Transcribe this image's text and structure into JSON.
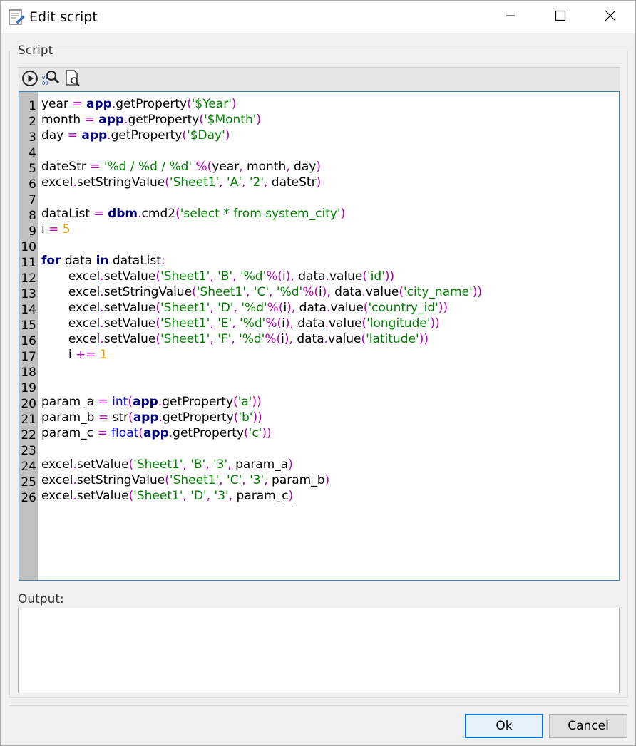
{
  "window": {
    "title": "Edit script",
    "minimize_icon": "minimize-icon",
    "maximize_icon": "maximize-icon",
    "close_icon": "close-icon"
  },
  "script_group": {
    "label": "Script"
  },
  "toolbar": {
    "buttons": [
      {
        "name": "run-icon"
      },
      {
        "name": "find-code-icon"
      },
      {
        "name": "preview-icon"
      }
    ]
  },
  "editor": {
    "lines": [
      {
        "n": "1",
        "tokens": [
          [
            "t",
            "year "
          ],
          [
            "op",
            "="
          ],
          [
            "t",
            " "
          ],
          [
            "kw",
            "app"
          ],
          [
            "op",
            "."
          ],
          [
            "t",
            "getProperty"
          ],
          [
            "op",
            "("
          ],
          [
            "str",
            "'$Year'"
          ],
          [
            "op",
            ")"
          ]
        ]
      },
      {
        "n": "2",
        "tokens": [
          [
            "t",
            "month "
          ],
          [
            "op",
            "="
          ],
          [
            "t",
            " "
          ],
          [
            "kw",
            "app"
          ],
          [
            "op",
            "."
          ],
          [
            "t",
            "getProperty"
          ],
          [
            "op",
            "("
          ],
          [
            "str",
            "'$Month'"
          ],
          [
            "op",
            ")"
          ]
        ]
      },
      {
        "n": "3",
        "tokens": [
          [
            "t",
            "day "
          ],
          [
            "op",
            "="
          ],
          [
            "t",
            " "
          ],
          [
            "kw",
            "app"
          ],
          [
            "op",
            "."
          ],
          [
            "t",
            "getProperty"
          ],
          [
            "op",
            "("
          ],
          [
            "str",
            "'$Day'"
          ],
          [
            "op",
            ")"
          ]
        ]
      },
      {
        "n": "4",
        "tokens": []
      },
      {
        "n": "5",
        "tokens": [
          [
            "t",
            "dateStr "
          ],
          [
            "op",
            "="
          ],
          [
            "t",
            " "
          ],
          [
            "str",
            "'%d / %d / %d'"
          ],
          [
            "t",
            " "
          ],
          [
            "op",
            "%("
          ],
          [
            "t",
            "year"
          ],
          [
            "op",
            ","
          ],
          [
            "t",
            " month"
          ],
          [
            "op",
            ","
          ],
          [
            "t",
            " day"
          ],
          [
            "op",
            ")"
          ]
        ]
      },
      {
        "n": "6",
        "tokens": [
          [
            "t",
            "excel"
          ],
          [
            "op",
            "."
          ],
          [
            "t",
            "setStringValue"
          ],
          [
            "op",
            "("
          ],
          [
            "str",
            "'Sheet1'"
          ],
          [
            "op",
            ","
          ],
          [
            "t",
            " "
          ],
          [
            "str",
            "'A'"
          ],
          [
            "op",
            ","
          ],
          [
            "t",
            " "
          ],
          [
            "str",
            "'2'"
          ],
          [
            "op",
            ","
          ],
          [
            "t",
            " dateStr"
          ],
          [
            "op",
            ")"
          ]
        ]
      },
      {
        "n": "7",
        "tokens": []
      },
      {
        "n": "8",
        "tokens": [
          [
            "t",
            "dataList "
          ],
          [
            "op",
            "="
          ],
          [
            "t",
            " "
          ],
          [
            "kw",
            "dbm"
          ],
          [
            "op",
            "."
          ],
          [
            "t",
            "cmd2"
          ],
          [
            "op",
            "("
          ],
          [
            "str",
            "'select * from system_city'"
          ],
          [
            "op",
            ")"
          ]
        ]
      },
      {
        "n": "9",
        "tokens": [
          [
            "t",
            "i "
          ],
          [
            "op",
            "="
          ],
          [
            "t",
            " "
          ],
          [
            "num",
            "5"
          ]
        ]
      },
      {
        "n": "10",
        "tokens": []
      },
      {
        "n": "11",
        "tokens": [
          [
            "kw",
            "for"
          ],
          [
            "t",
            " data "
          ],
          [
            "kw",
            "in"
          ],
          [
            "t",
            " dataList"
          ],
          [
            "op",
            ":"
          ]
        ]
      },
      {
        "n": "12",
        "tokens": [
          [
            "t",
            "       excel"
          ],
          [
            "op",
            "."
          ],
          [
            "t",
            "setValue"
          ],
          [
            "op",
            "("
          ],
          [
            "str",
            "'Sheet1'"
          ],
          [
            "op",
            ","
          ],
          [
            "t",
            " "
          ],
          [
            "str",
            "'B'"
          ],
          [
            "op",
            ","
          ],
          [
            "t",
            " "
          ],
          [
            "str",
            "'%d'"
          ],
          [
            "op",
            "%("
          ],
          [
            "t",
            "i"
          ],
          [
            "op",
            "),"
          ],
          [
            "t",
            " data"
          ],
          [
            "op",
            "."
          ],
          [
            "t",
            "value"
          ],
          [
            "op",
            "("
          ],
          [
            "str",
            "'id'"
          ],
          [
            "op",
            "))"
          ]
        ]
      },
      {
        "n": "13",
        "tokens": [
          [
            "t",
            "       excel"
          ],
          [
            "op",
            "."
          ],
          [
            "t",
            "setStringValue"
          ],
          [
            "op",
            "("
          ],
          [
            "str",
            "'Sheet1'"
          ],
          [
            "op",
            ","
          ],
          [
            "t",
            " "
          ],
          [
            "str",
            "'C'"
          ],
          [
            "op",
            ","
          ],
          [
            "t",
            " "
          ],
          [
            "str",
            "'%d'"
          ],
          [
            "op",
            "%("
          ],
          [
            "t",
            "i"
          ],
          [
            "op",
            "),"
          ],
          [
            "t",
            " data"
          ],
          [
            "op",
            "."
          ],
          [
            "t",
            "value"
          ],
          [
            "op",
            "("
          ],
          [
            "str",
            "'city_name'"
          ],
          [
            "op",
            "))"
          ]
        ]
      },
      {
        "n": "14",
        "tokens": [
          [
            "t",
            "       excel"
          ],
          [
            "op",
            "."
          ],
          [
            "t",
            "setValue"
          ],
          [
            "op",
            "("
          ],
          [
            "str",
            "'Sheet1'"
          ],
          [
            "op",
            ","
          ],
          [
            "t",
            " "
          ],
          [
            "str",
            "'D'"
          ],
          [
            "op",
            ","
          ],
          [
            "t",
            " "
          ],
          [
            "str",
            "'%d'"
          ],
          [
            "op",
            "%("
          ],
          [
            "t",
            "i"
          ],
          [
            "op",
            "),"
          ],
          [
            "t",
            " data"
          ],
          [
            "op",
            "."
          ],
          [
            "t",
            "value"
          ],
          [
            "op",
            "("
          ],
          [
            "str",
            "'country_id'"
          ],
          [
            "op",
            "))"
          ]
        ]
      },
      {
        "n": "15",
        "tokens": [
          [
            "t",
            "       excel"
          ],
          [
            "op",
            "."
          ],
          [
            "t",
            "setValue"
          ],
          [
            "op",
            "("
          ],
          [
            "str",
            "'Sheet1'"
          ],
          [
            "op",
            ","
          ],
          [
            "t",
            " "
          ],
          [
            "str",
            "'E'"
          ],
          [
            "op",
            ","
          ],
          [
            "t",
            " "
          ],
          [
            "str",
            "'%d'"
          ],
          [
            "op",
            "%("
          ],
          [
            "t",
            "i"
          ],
          [
            "op",
            "),"
          ],
          [
            "t",
            " data"
          ],
          [
            "op",
            "."
          ],
          [
            "t",
            "value"
          ],
          [
            "op",
            "("
          ],
          [
            "str",
            "'longitude'"
          ],
          [
            "op",
            "))"
          ]
        ]
      },
      {
        "n": "16",
        "tokens": [
          [
            "t",
            "       excel"
          ],
          [
            "op",
            "."
          ],
          [
            "t",
            "setValue"
          ],
          [
            "op",
            "("
          ],
          [
            "str",
            "'Sheet1'"
          ],
          [
            "op",
            ","
          ],
          [
            "t",
            " "
          ],
          [
            "str",
            "'F'"
          ],
          [
            "op",
            ","
          ],
          [
            "t",
            " "
          ],
          [
            "str",
            "'%d'"
          ],
          [
            "op",
            "%("
          ],
          [
            "t",
            "i"
          ],
          [
            "op",
            "),"
          ],
          [
            "t",
            " data"
          ],
          [
            "op",
            "."
          ],
          [
            "t",
            "value"
          ],
          [
            "op",
            "("
          ],
          [
            "str",
            "'latitude'"
          ],
          [
            "op",
            "))"
          ]
        ]
      },
      {
        "n": "17",
        "tokens": [
          [
            "t",
            "       i "
          ],
          [
            "op",
            "+="
          ],
          [
            "t",
            " "
          ],
          [
            "num",
            "1"
          ]
        ]
      },
      {
        "n": "18",
        "tokens": []
      },
      {
        "n": "19",
        "tokens": []
      },
      {
        "n": "20",
        "tokens": [
          [
            "t",
            "param_a "
          ],
          [
            "op",
            "="
          ],
          [
            "t",
            " "
          ],
          [
            "bi",
            "int"
          ],
          [
            "op",
            "("
          ],
          [
            "kw",
            "app"
          ],
          [
            "op",
            "."
          ],
          [
            "t",
            "getProperty"
          ],
          [
            "op",
            "("
          ],
          [
            "str",
            "'a'"
          ],
          [
            "op",
            "))"
          ]
        ]
      },
      {
        "n": "21",
        "tokens": [
          [
            "t",
            "param_b "
          ],
          [
            "op",
            "="
          ],
          [
            "t",
            " str"
          ],
          [
            "op",
            "("
          ],
          [
            "kw",
            "app"
          ],
          [
            "op",
            "."
          ],
          [
            "t",
            "getProperty"
          ],
          [
            "op",
            "("
          ],
          [
            "str",
            "'b'"
          ],
          [
            "op",
            "))"
          ]
        ]
      },
      {
        "n": "22",
        "tokens": [
          [
            "t",
            "param_c "
          ],
          [
            "op",
            "="
          ],
          [
            "t",
            " "
          ],
          [
            "bi",
            "float"
          ],
          [
            "op",
            "("
          ],
          [
            "kw",
            "app"
          ],
          [
            "op",
            "."
          ],
          [
            "t",
            "getProperty"
          ],
          [
            "op",
            "("
          ],
          [
            "str",
            "'c'"
          ],
          [
            "op",
            "))"
          ]
        ]
      },
      {
        "n": "23",
        "tokens": []
      },
      {
        "n": "24",
        "tokens": [
          [
            "t",
            "excel"
          ],
          [
            "op",
            "."
          ],
          [
            "t",
            "setValue"
          ],
          [
            "op",
            "("
          ],
          [
            "str",
            "'Sheet1'"
          ],
          [
            "op",
            ","
          ],
          [
            "t",
            " "
          ],
          [
            "str",
            "'B'"
          ],
          [
            "op",
            ","
          ],
          [
            "t",
            " "
          ],
          [
            "str",
            "'3'"
          ],
          [
            "op",
            ","
          ],
          [
            "t",
            " param_a"
          ],
          [
            "op",
            ")"
          ]
        ]
      },
      {
        "n": "25",
        "tokens": [
          [
            "t",
            "excel"
          ],
          [
            "op",
            "."
          ],
          [
            "t",
            "setStringValue"
          ],
          [
            "op",
            "("
          ],
          [
            "str",
            "'Sheet1'"
          ],
          [
            "op",
            ","
          ],
          [
            "t",
            " "
          ],
          [
            "str",
            "'C'"
          ],
          [
            "op",
            ","
          ],
          [
            "t",
            " "
          ],
          [
            "str",
            "'3'"
          ],
          [
            "op",
            ","
          ],
          [
            "t",
            " param_b"
          ],
          [
            "op",
            ")"
          ]
        ]
      },
      {
        "n": "26",
        "tokens": [
          [
            "t",
            "excel"
          ],
          [
            "op",
            "."
          ],
          [
            "t",
            "setValue"
          ],
          [
            "op",
            "("
          ],
          [
            "str",
            "'Sheet1'"
          ],
          [
            "op",
            ","
          ],
          [
            "t",
            " "
          ],
          [
            "str",
            "'D'"
          ],
          [
            "op",
            ","
          ],
          [
            "t",
            " "
          ],
          [
            "str",
            "'3'"
          ],
          [
            "op",
            ","
          ],
          [
            "t",
            " param_c"
          ],
          [
            "op",
            ")"
          ]
        ],
        "cursor": true
      }
    ]
  },
  "output": {
    "label": "Output:",
    "value": ""
  },
  "buttons": {
    "ok": "Ok",
    "cancel": "Cancel"
  },
  "colors": {
    "keyword": "#00007f",
    "operator": "#b000b0",
    "string": "#007f00",
    "number": "#e8a000",
    "builtin": "#0000ff",
    "editor_border": "#3c7fb1",
    "ok_border": "#0078d7"
  }
}
